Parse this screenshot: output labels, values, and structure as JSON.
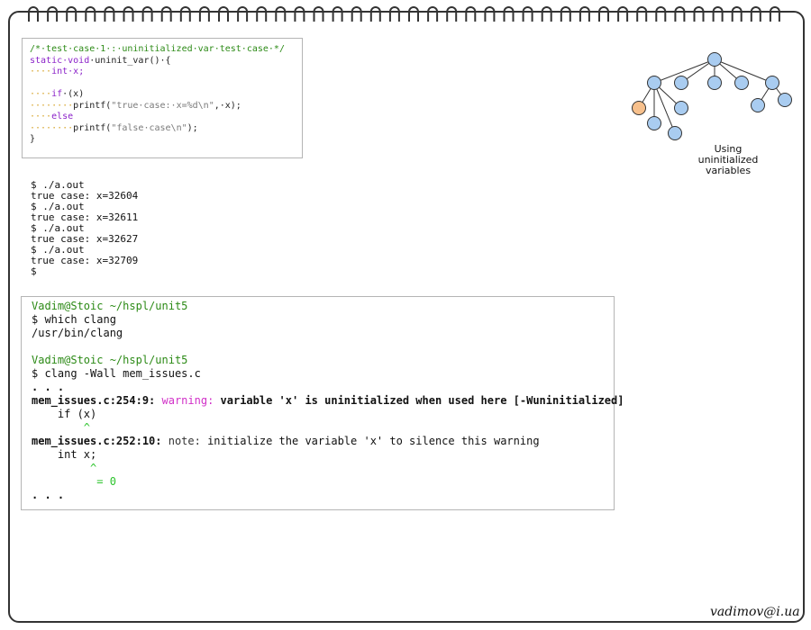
{
  "code_snippet": {
    "comment": "/*·test·case·1·:·uninitialized·var·test·case·*/",
    "sig_kw": "static·void",
    "sig_rest": "·uninit_var()·{",
    "decl_ws": "····",
    "decl": "int·x;",
    "if_ws": "····",
    "if_kw": "if",
    "if_rest": "·(x)",
    "p1_ws": "········",
    "p1_fn": "printf(",
    "p1_str": "\"true·case:·x=%d\\n\"",
    "p1_rest": ",·x);",
    "else_ws": "····",
    "else_kw": "else",
    "p2_ws": "········",
    "p2_fn": "printf(",
    "p2_str": "\"false·case\\n\"",
    "p2_rest": ");",
    "close": "}"
  },
  "run_output": [
    "$ ./a.out",
    "true case: x=32604",
    "$ ./a.out",
    "true case: x=32611",
    "$ ./a.out",
    "true case: x=32627",
    "$ ./a.out",
    "true case: x=32709",
    "$"
  ],
  "terminal": {
    "p1_user": "Vadim@Stoic",
    "p1_path": " ~/hspl/unit5",
    "cmd1": "$ which clang",
    "out1": "/usr/bin/clang",
    "p2_user": "Vadim@Stoic",
    "p2_path": " ~/hspl/unit5",
    "cmd2": "$ clang -Wall mem_issues.c",
    "dots1": ". . .",
    "w_loc": "mem_issues.c:254:9:",
    "w_label": " warning:",
    "w_msg": " variable 'x' is uninitialized when used here [-Wuninitialized]",
    "w_src": "    if (x)",
    "w_caret": "        ^",
    "n_loc": "mem_issues.c:252:10:",
    "n_label": " note:",
    "n_msg": " initialize the variable 'x' to silence this warning",
    "n_src": "    int x;",
    "n_caret": "         ^",
    "n_fix": "          = 0",
    "dots2": ". . ."
  },
  "tree": {
    "caption_line1": "Using",
    "caption_line2": "uninitialized",
    "caption_line3": "variables",
    "node_color": "#a9ccf0",
    "highlight_color": "#f7c08c"
  },
  "footer": {
    "email": "vadimov@i.ua"
  }
}
